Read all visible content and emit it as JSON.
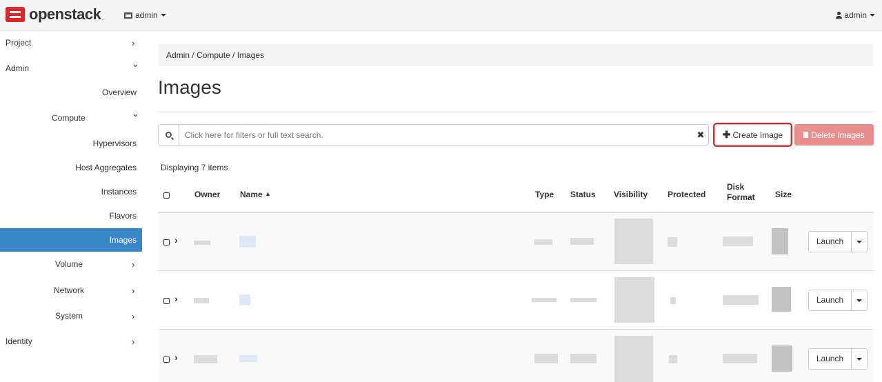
{
  "topbar": {
    "logo_text": "openstack",
    "logo_dot": ".",
    "project_menu": "admin",
    "user_menu": "admin"
  },
  "sidebar": {
    "items": [
      {
        "label": "Project",
        "chevron": "›"
      },
      {
        "label": "Admin",
        "chevron": "⌄"
      },
      {
        "label": "Overview"
      },
      {
        "label": "Compute",
        "chevron": "⌄"
      },
      {
        "label": "Hypervisors"
      },
      {
        "label": "Host Aggregates"
      },
      {
        "label": "Instances"
      },
      {
        "label": "Flavors"
      },
      {
        "label": "Images"
      },
      {
        "label": "Volume",
        "chevron": "›"
      },
      {
        "label": "Network",
        "chevron": "›"
      },
      {
        "label": "System",
        "chevron": "›"
      },
      {
        "label": "Identity",
        "chevron": "›"
      }
    ]
  },
  "breadcrumb": "Admin /  Compute /  Images",
  "page_title": "Images",
  "search": {
    "placeholder": "Click here for filters or full text search.",
    "clear": "✖"
  },
  "actions": {
    "create": "Create Image",
    "create_icon": "✚",
    "delete": "Delete Images"
  },
  "table": {
    "count": "Displaying 7 items",
    "headers": {
      "owner": "Owner",
      "name": "Name",
      "sort_arrow": "▲",
      "type": "Type",
      "status": "Status",
      "visibility": "Visibility",
      "protected": "Protected",
      "disk_format_1": "Disk",
      "disk_format_2": "Format",
      "size": "Size"
    },
    "row_action": "Launch",
    "expander": "›",
    "rows": 3
  },
  "colors": {
    "accent": "#3a87c8",
    "danger": "#e89090",
    "highlight": "#d9232d"
  }
}
